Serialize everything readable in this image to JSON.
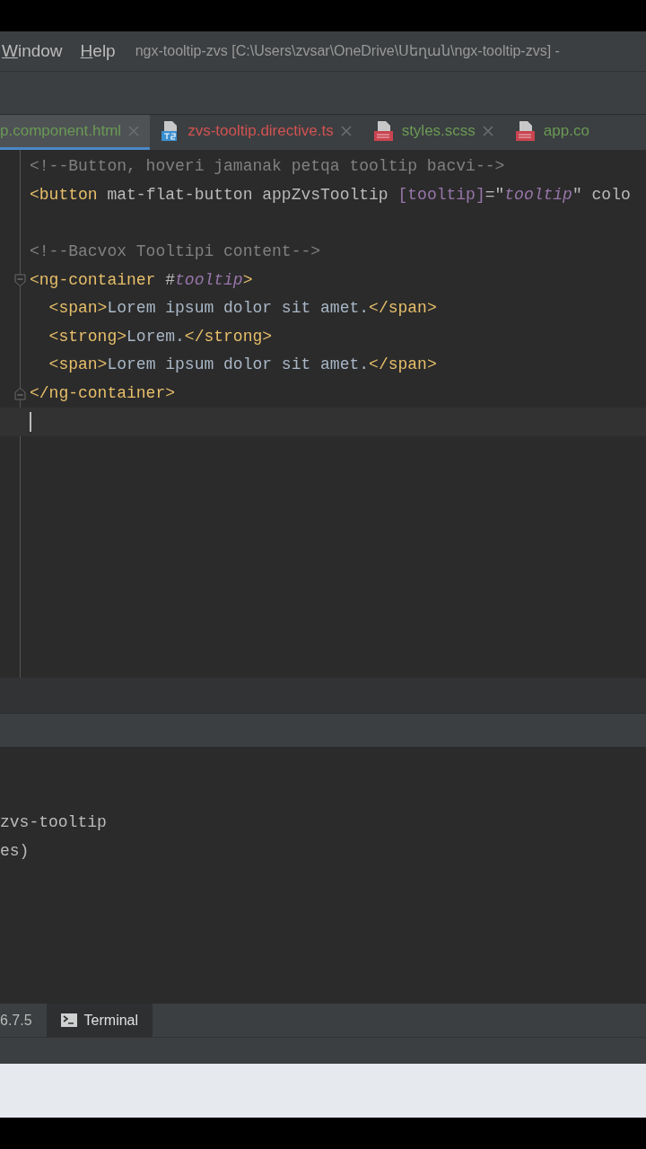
{
  "menu": [
    {
      "label": "Window"
    },
    {
      "label": "Help"
    }
  ],
  "window": {
    "title": "ngx-tooltip-zvs [C:\\Users\\zvsar\\OneDrive\\Սեղան\\ngx-tooltip-zvs] -"
  },
  "tabs": [
    {
      "label": "p.component.html",
      "kind": "html",
      "color": "#6a9955",
      "selected": true
    },
    {
      "label": "zvs-tooltip.directive.ts",
      "kind": "ts",
      "color": "#d25252",
      "selected": false
    },
    {
      "label": "styles.scss",
      "kind": "sass",
      "color": "#6a9955",
      "selected": false
    },
    {
      "label": "app.co",
      "kind": "sass",
      "color": "#6a9955",
      "selected": false
    }
  ],
  "editor": {
    "lines": [
      {
        "kind": "code",
        "segments": [
          {
            "kind": "comment",
            "text": "<!--Button, hoveri jamanak petqa tooltip bacvi-->"
          }
        ]
      },
      {
        "kind": "code",
        "segments": [
          {
            "kind": "tag",
            "text": "<button "
          },
          {
            "kind": "attr",
            "text": "mat-flat-button appZvsTooltip "
          },
          {
            "kind": "binding",
            "text": "[tooltip]"
          },
          {
            "kind": "attr",
            "text": "=\""
          },
          {
            "kind": "variable",
            "text": "tooltip"
          },
          {
            "kind": "attr",
            "text": "\" colo"
          }
        ]
      },
      {
        "kind": "blank"
      },
      {
        "kind": "code",
        "segments": [
          {
            "kind": "comment",
            "text": "<!--Bacvox Tooltipi content-->"
          }
        ]
      },
      {
        "kind": "fold-start",
        "segments": [
          {
            "kind": "tag",
            "text": "<ng-container "
          },
          {
            "kind": "attr",
            "text": "#"
          },
          {
            "kind": "variable",
            "text": "tooltip"
          },
          {
            "kind": "tag",
            "text": ">"
          }
        ]
      },
      {
        "kind": "code",
        "segments": [
          {
            "kind": "tag",
            "text": "  <span>"
          },
          {
            "kind": "text",
            "text": "Lorem ipsum dolor sit amet."
          },
          {
            "kind": "tag",
            "text": "</span>"
          }
        ]
      },
      {
        "kind": "code",
        "segments": [
          {
            "kind": "tag",
            "text": "  <strong>"
          },
          {
            "kind": "text",
            "text": "Lorem."
          },
          {
            "kind": "tag",
            "text": "</strong>"
          }
        ]
      },
      {
        "kind": "code",
        "segments": [
          {
            "kind": "tag",
            "text": "  <span>"
          },
          {
            "kind": "text",
            "text": "Lorem ipsum dolor sit amet."
          },
          {
            "kind": "tag",
            "text": "</span>"
          }
        ]
      },
      {
        "kind": "fold-end",
        "segments": [
          {
            "kind": "tag",
            "text": "</ng-container>"
          }
        ]
      },
      {
        "kind": "caret"
      }
    ]
  },
  "terminal": {
    "lines": [
      "zvs-tooltip",
      "es)"
    ]
  },
  "bottom_tabs": [
    {
      "label": "6.7.5",
      "kind": "plain",
      "selected": false
    },
    {
      "label": "Terminal",
      "kind": "terminal",
      "selected": true
    }
  ]
}
